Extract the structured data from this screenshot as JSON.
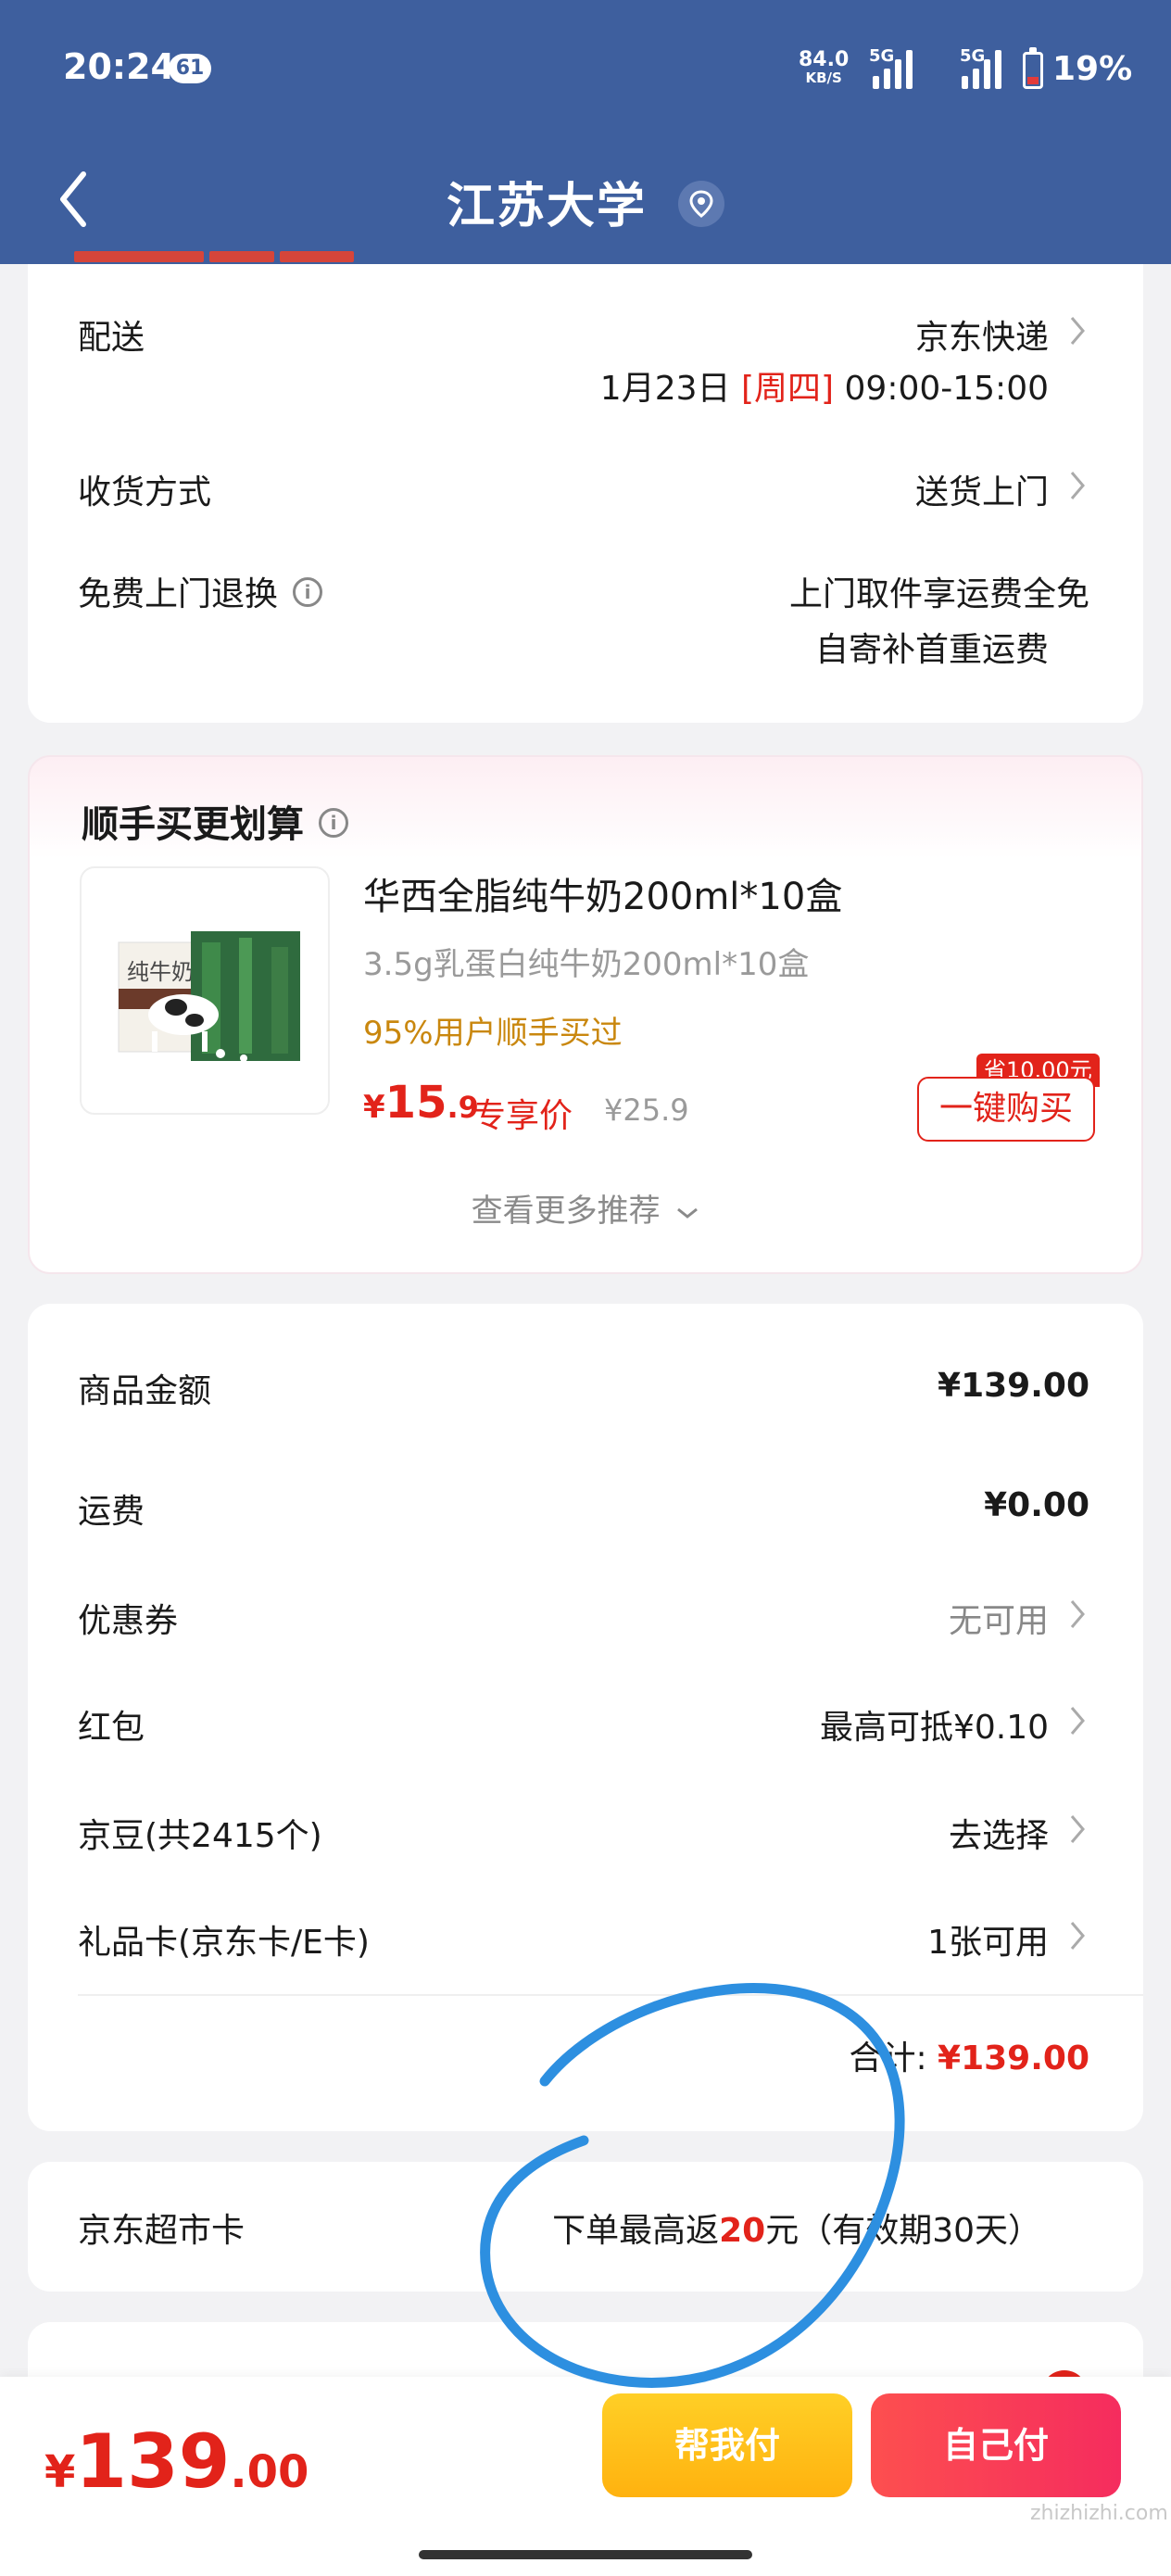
{
  "status_bar": {
    "time": "20:24",
    "notification_count": "61",
    "net_speed": "84.0",
    "net_unit": "KB/S",
    "sig1": "5G",
    "sig2": "5G",
    "battery": "19%"
  },
  "header": {
    "title": "江苏大学",
    "icons": [
      "back-icon",
      "location-pin-icon"
    ]
  },
  "delivery": {
    "shipping_label": "配送",
    "shipping_value": "京东快递",
    "date_prefix": "1月23日",
    "date_weekday": "[周四]",
    "date_time": "09:00-15:00",
    "receive_label": "收货方式",
    "receive_value": "送货上门",
    "return_label": "免费上门退换",
    "return_line1": "上门取件享运费全免",
    "return_line2": "自寄补首重运费"
  },
  "recommend": {
    "title": "顺手买更划算",
    "product_name": "华西全脂纯牛奶200ml*10盒",
    "product_sub": "3.5g乳蛋白纯牛奶200ml*10盒",
    "product_tag": "95%用户顺手买过",
    "price_cur": "¥",
    "price_int": "15",
    "price_dec": ".9",
    "exclusive": "专享价",
    "original": "¥25.9",
    "save_tag": "省10.00元",
    "buy_button": "一键购买",
    "more": "查看更多推荐",
    "thumb_text": "纯牛奶"
  },
  "amounts": {
    "goods_label": "商品金额",
    "goods_value": "¥139.00",
    "freight_label": "运费",
    "freight_value": "¥0.00",
    "coupon_label": "优惠券",
    "coupon_value": "无可用",
    "redpacket_label": "红包",
    "redpacket_value": "最高可抵¥0.10",
    "jingdou_label": "京豆(共2415个)",
    "jingdou_value": "去选择",
    "giftcard_label": "礼品卡(京东卡/E卡)",
    "giftcard_value": "1张可用",
    "sum_label": "合计:",
    "sum_value": "¥139.00"
  },
  "market_card": {
    "label": "京东超市卡",
    "value_prefix": "下单最高返",
    "value_highlight": "20",
    "value_suffix": "元（有效期30天）"
  },
  "bottom": {
    "total_cur": "¥",
    "total_int": "139",
    "total_dec": ".00",
    "help_pay": "帮我付",
    "self_pay": "自己付",
    "watermark": "zhizhizhi.com"
  },
  "colors": {
    "header": "#3e5f9e",
    "accent_red": "#e2231a",
    "help_yellow": "#ffbf1a",
    "annotation_blue": "#2d8fe0"
  }
}
